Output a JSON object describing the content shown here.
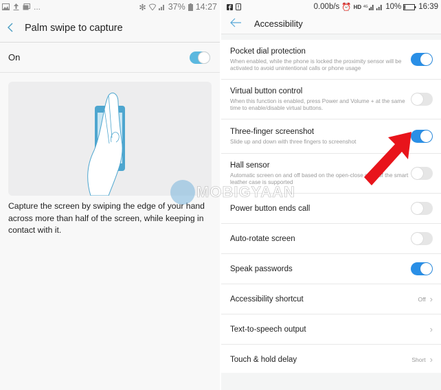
{
  "left": {
    "status_bar": {
      "icons_left": [
        "image-icon",
        "upload-icon",
        "screenshot-icon"
      ],
      "more": "...",
      "icons_right": [
        "bluetooth-icon",
        "wifi-icon",
        "signal-icon"
      ],
      "battery": "37%",
      "time": "14:27"
    },
    "header": {
      "title": "Palm swipe to capture"
    },
    "toggle_row": {
      "label": "On",
      "enabled": true
    },
    "description": "Capture the screen by swiping the edge of your hand across more than half of the screen, while keeping in contact with it."
  },
  "right": {
    "status_bar": {
      "icons_left": [
        "facebook-icon",
        "notification-icon"
      ],
      "speed": "0.00b/s",
      "icons_right": [
        "alarm-icon",
        "hd-icon",
        "4g-signal-icon",
        "signal-icon"
      ],
      "battery": "10%",
      "time": "16:39"
    },
    "header": {
      "title": "Accessibility"
    },
    "items": [
      {
        "title": "Pocket dial protection",
        "subtitle": "When enabled, while the phone is locked the proximity sensor will be activated to avoid unintentional calls or phone usage",
        "type": "toggle",
        "on": true
      },
      {
        "title": "Virtual button control",
        "subtitle": "When this function is enabled, press Power and Volume + at the same time to enable/disable virtual buttons.",
        "type": "toggle",
        "on": false
      },
      {
        "title": "Three-finger screenshot",
        "subtitle": "Slide up and down with three fingers to screenshot",
        "type": "toggle",
        "on": true
      },
      {
        "title": "Hall sensor",
        "subtitle": "Automatic screen on and off based on the open-close state of the smart leather case is supported",
        "type": "toggle",
        "on": false
      },
      {
        "title": "Power button ends call",
        "type": "toggle",
        "on": false
      },
      {
        "title": "Auto-rotate screen",
        "type": "toggle",
        "on": false
      },
      {
        "title": "Speak passwords",
        "type": "toggle",
        "on": true
      },
      {
        "title": "Accessibility shortcut",
        "type": "link",
        "value": "Off"
      },
      {
        "title": "Text-to-speech output",
        "type": "link",
        "value": ""
      },
      {
        "title": "Touch & hold delay",
        "type": "link",
        "value": "Short"
      }
    ]
  },
  "watermark": "MOBIGYAAN",
  "colors": {
    "toggle_on_left": "#5bb8df",
    "toggle_on_right": "#2a8fe6",
    "toggle_off": "#e6e6e6",
    "arrow": "#e8141b",
    "accent": "#4a9cc2"
  }
}
